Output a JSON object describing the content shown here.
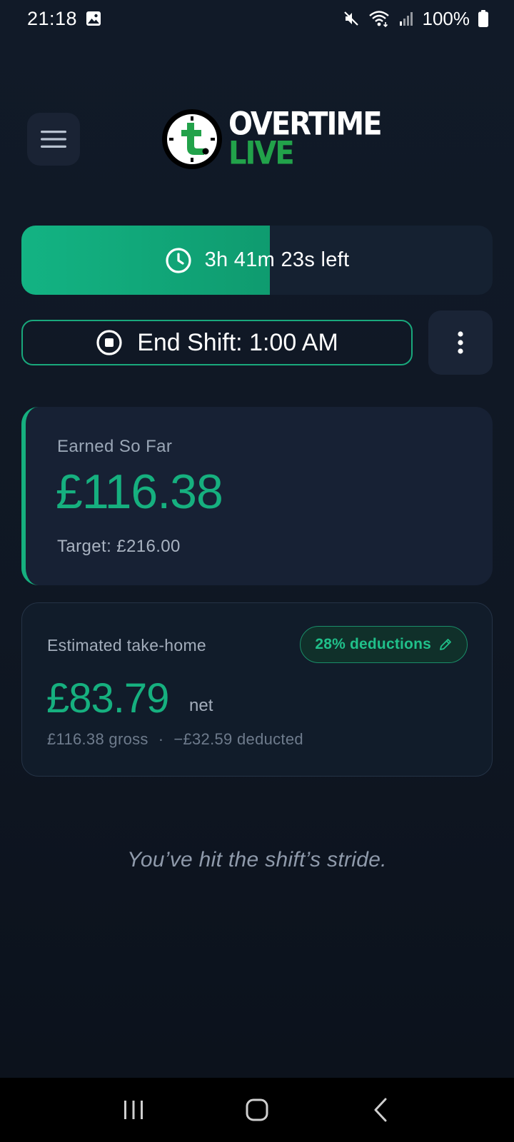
{
  "status_bar": {
    "time": "21:18",
    "battery": "100%",
    "icons": [
      "image-icon",
      "mute-icon",
      "wifi-icon",
      "signal-icon",
      "battery-icon"
    ]
  },
  "header": {
    "menu_icon": "hamburger-menu-icon",
    "logo": {
      "word1": "OVERTIME",
      "word2": "LIVE",
      "badge_icon": "clock-t-logo-icon"
    }
  },
  "progress": {
    "text": "3h 41m 23s left",
    "fraction_elapsed": 0.527,
    "icon": "clock-icon"
  },
  "end_shift": {
    "label": "End Shift: 1:00 AM",
    "icon": "stop-icon"
  },
  "more_menu": {
    "icon": "more-vertical-icon"
  },
  "earned": {
    "label": "Earned So Far",
    "value": "£116.38",
    "target": "Target: £216.00"
  },
  "takehome": {
    "label": "Estimated take-home",
    "deductions": "28% deductions",
    "deductions_icon": "pencil-icon",
    "value": "£83.79",
    "net_label": "net",
    "gross": "£116.38 gross",
    "separator": "·",
    "deducted": "−£32.59 deducted"
  },
  "quote": "You’ve hit the shift’s stride.",
  "nav": {
    "recent_icon": "recent-apps-icon",
    "home_icon": "home-icon",
    "back_icon": "back-icon"
  },
  "colors": {
    "accent": "#16b07f",
    "background": "#111a28",
    "card": "#172134",
    "logo_green": "#22a24a"
  }
}
